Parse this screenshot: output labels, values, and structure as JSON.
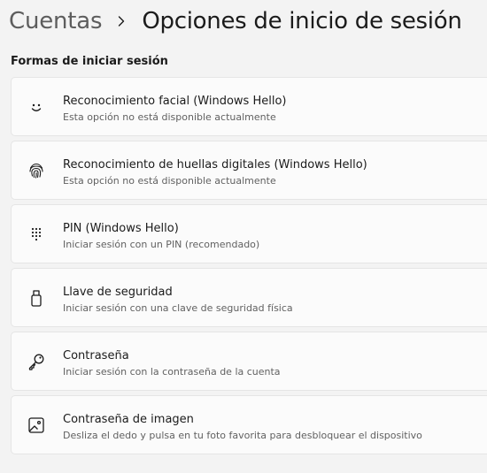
{
  "breadcrumb": {
    "parent": "Cuentas",
    "current": "Opciones de inicio de sesión"
  },
  "section": {
    "title": "Formas de iniciar sesión"
  },
  "options": [
    {
      "title": "Reconocimiento facial (Windows Hello)",
      "subtitle": "Esta opción no está disponible actualmente",
      "icon": "face-icon"
    },
    {
      "title": "Reconocimiento de huellas digitales (Windows Hello)",
      "subtitle": "Esta opción no está disponible actualmente",
      "icon": "fingerprint-icon"
    },
    {
      "title": "PIN (Windows Hello)",
      "subtitle": "Iniciar sesión con un PIN (recomendado)",
      "icon": "keypad-icon"
    },
    {
      "title": "Llave de seguridad",
      "subtitle": "Iniciar sesión con una clave de seguridad física",
      "icon": "usb-key-icon"
    },
    {
      "title": "Contraseña",
      "subtitle": "Iniciar sesión con la contraseña de la cuenta",
      "icon": "key-icon"
    },
    {
      "title": "Contraseña de imagen",
      "subtitle": "Desliza el dedo y pulsa en tu foto favorita para desbloquear el dispositivo",
      "icon": "picture-icon"
    }
  ],
  "colors": {
    "background": "#f3f3f3",
    "card": "#fbfbfb",
    "card_border": "#e5e5e5",
    "text_primary": "#1b1b1b",
    "text_secondary": "#616161",
    "breadcrumb_parent": "#5d5d5d"
  }
}
